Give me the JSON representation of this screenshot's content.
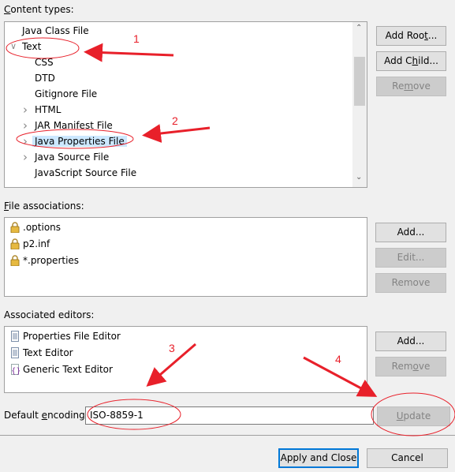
{
  "content_types": {
    "label": "Content types:",
    "tree": [
      {
        "label": "Java Class File",
        "level": 0,
        "expander": "none"
      },
      {
        "label": "Text",
        "level": 0,
        "expander": "expanded"
      },
      {
        "label": "CSS",
        "level": 1,
        "expander": "none"
      },
      {
        "label": "DTD",
        "level": 1,
        "expander": "none"
      },
      {
        "label": "Gitignore File",
        "level": 1,
        "expander": "none"
      },
      {
        "label": "HTML",
        "level": 1,
        "expander": "collapsed"
      },
      {
        "label": "JAR Manifest File",
        "level": 1,
        "expander": "collapsed"
      },
      {
        "label": "Java Properties File",
        "level": 1,
        "expander": "collapsed",
        "selected": true
      },
      {
        "label": "Java Source File",
        "level": 1,
        "expander": "collapsed"
      },
      {
        "label": "JavaScript Source File",
        "level": 1,
        "expander": "none"
      }
    ],
    "buttons": {
      "add_root": "Add Root...",
      "add_child": "Add Child...",
      "remove": "Remove"
    }
  },
  "file_associations": {
    "label": "File associations:",
    "items": [
      ".options",
      "p2.inf",
      "*.properties"
    ],
    "item_icon": "lock-icon",
    "buttons": {
      "add": "Add...",
      "edit": "Edit...",
      "remove": "Remove"
    }
  },
  "associated_editors": {
    "label": "Associated editors:",
    "items": [
      {
        "label": "Properties File Editor",
        "icon": "document-icon"
      },
      {
        "label": "Text Editor",
        "icon": "document-icon"
      },
      {
        "label": "Generic Text Editor",
        "icon": "generic-editor-icon"
      }
    ],
    "buttons": {
      "add": "Add...",
      "remove": "Remove"
    }
  },
  "encoding": {
    "label": "Default encoding:",
    "value": "ISO-8859-1",
    "update": "Update"
  },
  "footer": {
    "apply_close": "Apply and Close",
    "cancel": "Cancel"
  },
  "annotations": {
    "color": "#e8202a",
    "numbers": [
      "1",
      "2",
      "3",
      "4"
    ]
  },
  "colors": {
    "selection": "#cce8ff",
    "default_button_border": "#0078d7"
  }
}
